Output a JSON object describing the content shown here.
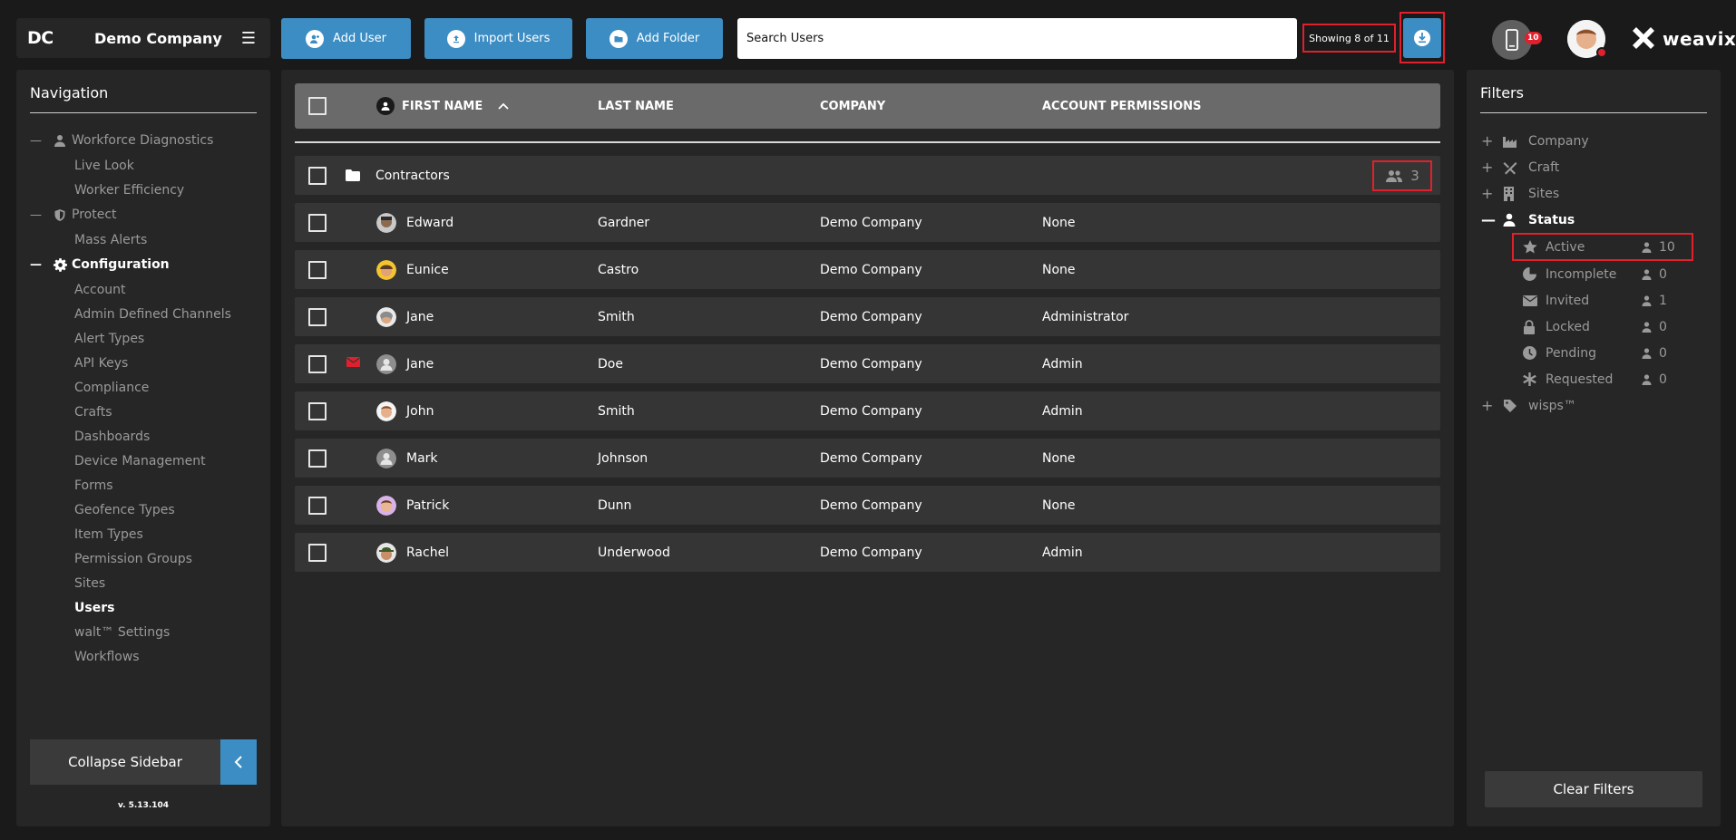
{
  "brand": {
    "initials": "DC",
    "company": "Demo Company"
  },
  "toolbar": {
    "add_user": "Add User",
    "import_users": "Import Users",
    "add_folder": "Add Folder",
    "search_placeholder": "Search Users",
    "showing": "Showing 8 of 11",
    "device_badge": "10",
    "logo_text": "weavix"
  },
  "colors": {
    "accent": "#3c8dc3",
    "highlight": "#e0202c",
    "background": "#1a1a1a",
    "panel": "#262626",
    "row": "#353535"
  },
  "sidebar": {
    "title": "Navigation",
    "groups": [
      {
        "label": "Workforce Diagnostics",
        "icon": "person-icon",
        "items": [
          "Live Look",
          "Worker Efficiency"
        ]
      },
      {
        "label": "Protect",
        "icon": "shield-icon",
        "items": [
          "Mass Alerts"
        ]
      },
      {
        "label": "Configuration",
        "icon": "gear-icon",
        "items": [
          "Account",
          "Admin Defined Channels",
          "Alert Types",
          "API Keys",
          "Compliance",
          "Crafts",
          "Dashboards",
          "Device Management",
          "Forms",
          "Geofence Types",
          "Item Types",
          "Permission Groups",
          "Sites",
          "Users",
          "walt™ Settings",
          "Workflows"
        ]
      }
    ],
    "collapse_label": "Collapse Sidebar",
    "version": "v. 5.13.104"
  },
  "table": {
    "headers": {
      "first_name": "FIRST NAME",
      "last_name": "LAST NAME",
      "company": "COMPANY",
      "permissions": "ACCOUNT PERMISSIONS"
    },
    "folder": {
      "name": "Contractors",
      "count": "3"
    },
    "rows": [
      {
        "first": "Edward",
        "last": "Gardner",
        "company": "Demo Company",
        "permissions": "None"
      },
      {
        "first": "Eunice",
        "last": "Castro",
        "company": "Demo Company",
        "permissions": "None"
      },
      {
        "first": "Jane",
        "last": "Smith",
        "company": "Demo Company",
        "permissions": "Administrator"
      },
      {
        "first": "Jane",
        "last": "Doe",
        "company": "Demo Company",
        "permissions": "Admin"
      },
      {
        "first": "John",
        "last": "Smith",
        "company": "Demo Company",
        "permissions": "Admin"
      },
      {
        "first": "Mark",
        "last": "Johnson",
        "company": "Demo Company",
        "permissions": "None"
      },
      {
        "first": "Patrick",
        "last": "Dunn",
        "company": "Demo Company",
        "permissions": "None"
      },
      {
        "first": "Rachel",
        "last": "Underwood",
        "company": "Demo Company",
        "permissions": "Admin"
      }
    ]
  },
  "filters": {
    "title": "Filters",
    "groups": [
      {
        "label": "Company",
        "icon": "factory-icon"
      },
      {
        "label": "Craft",
        "icon": "tools-icon"
      },
      {
        "label": "Sites",
        "icon": "building-icon"
      },
      {
        "label": "Status",
        "icon": "person-icon"
      },
      {
        "label": "wisps™",
        "icon": "tag-icon"
      }
    ],
    "status_items": [
      {
        "label": "Active",
        "count": "10",
        "icon": "star-icon"
      },
      {
        "label": "Incomplete",
        "count": "0",
        "icon": "half-circle-icon"
      },
      {
        "label": "Invited",
        "count": "1",
        "icon": "envelope-icon"
      },
      {
        "label": "Locked",
        "count": "0",
        "icon": "lock-icon"
      },
      {
        "label": "Pending",
        "count": "0",
        "icon": "clock-icon"
      },
      {
        "label": "Requested",
        "count": "0",
        "icon": "asterisk-icon"
      }
    ],
    "clear_label": "Clear Filters"
  }
}
